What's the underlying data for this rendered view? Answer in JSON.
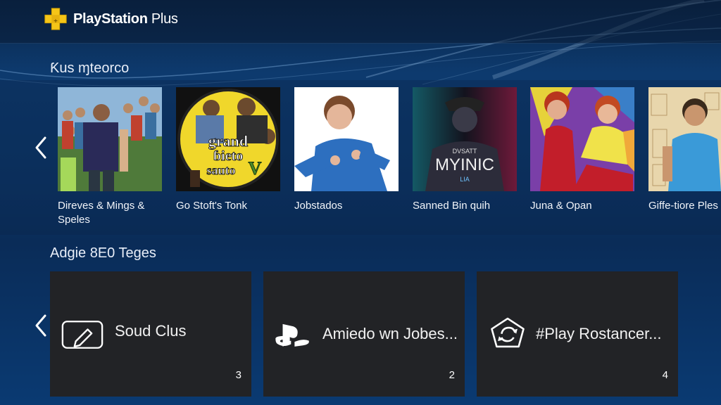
{
  "header": {
    "brand_bold": "PlayStation",
    "brand_light": " Plus",
    "logo_icon": "ps-plus-logo-icon",
    "accent_color": "#f5c518"
  },
  "row1": {
    "title": "Ƙus ɱteorco",
    "prev_icon": "chevron-left-icon",
    "items": [
      {
        "label": "Direves & Mings & Speles"
      },
      {
        "label": "Go Stoft's Tonk"
      },
      {
        "label": "Jobstados"
      },
      {
        "label": "Sanned Bin quih"
      },
      {
        "label": "Juna & Opan"
      },
      {
        "label": "Giffe-tiore Ples"
      }
    ],
    "cover_texts": {
      "card2_line1": "grand",
      "card2_line2": "ɓieto",
      "card2_line3": "sauto",
      "card4_line1": "DVSATT",
      "card4_line2": "MYINIC",
      "card4_line3": "LIA"
    }
  },
  "row2": {
    "title": "Adgie 8E0 Teges",
    "prev_icon": "chevron-left-icon",
    "tiles": [
      {
        "label": "Soud Clus",
        "count": "3",
        "icon": "pencil-box-icon"
      },
      {
        "label": "Amiedo wn Jobes...",
        "count": "2",
        "icon": "ps-logo-icon"
      },
      {
        "label": "#Play Rostancer...",
        "count": "4",
        "icon": "refresh-pentagon-icon"
      }
    ]
  }
}
